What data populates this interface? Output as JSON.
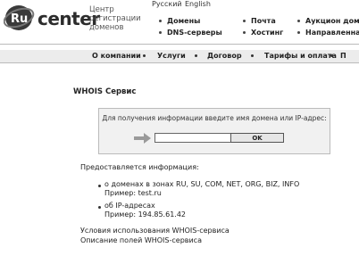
{
  "header": {
    "logo_text": "RU center",
    "tagline": [
      "Центр",
      "регистрации",
      "доменов"
    ],
    "languages": [
      "Русский",
      "English"
    ],
    "services": {
      "left": [
        "Домены",
        "DNS-серверы"
      ],
      "middle": [
        "Почта",
        "Хостинг"
      ],
      "right": [
        "Аукцион домен",
        "Направленная"
      ]
    }
  },
  "nav": {
    "items": [
      "О компании",
      "Услуги",
      "Договор",
      "Тарифы и оплата",
      "П"
    ]
  },
  "main": {
    "title": "WHOIS Сервис",
    "prompt": "Для получения информации введите имя домена или IP-адрес:",
    "input_value": "",
    "ok_label": "OK",
    "info_heading": "Предоставляется информация:",
    "items": [
      {
        "title": "о доменах в зонах RU, SU, COM, NET, ORG, BIZ, INFO",
        "example": "Пример: test.ru"
      },
      {
        "title": "об IP-адресах",
        "example": "Пример: 194.85.61.42"
      }
    ],
    "links": [
      "Условия использования WHOIS-сервиса",
      "Описание полей WHOIS-сервиса"
    ]
  }
}
